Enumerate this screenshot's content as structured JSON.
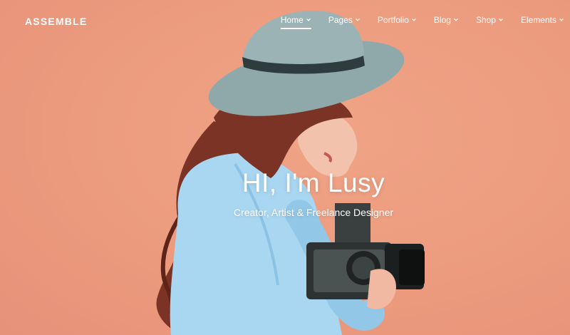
{
  "brand": {
    "logo": "ASSEMBLE"
  },
  "nav": {
    "items": [
      {
        "label": "Home",
        "active": true
      },
      {
        "label": "Pages"
      },
      {
        "label": "Portfolio"
      },
      {
        "label": "Blog"
      },
      {
        "label": "Shop"
      },
      {
        "label": "Elements"
      }
    ]
  },
  "hero": {
    "title": "HI, I'm Lusy",
    "subtitle": "Creator, Artist & Freelance Designer"
  },
  "colors": {
    "background": "#ec9b7e",
    "shirt": "#a9d6f1",
    "hat": "#8fa9aa",
    "hair": "#7a3325",
    "text": "#ffffff"
  },
  "icons": {
    "dropdown": "chevron-down-icon"
  }
}
